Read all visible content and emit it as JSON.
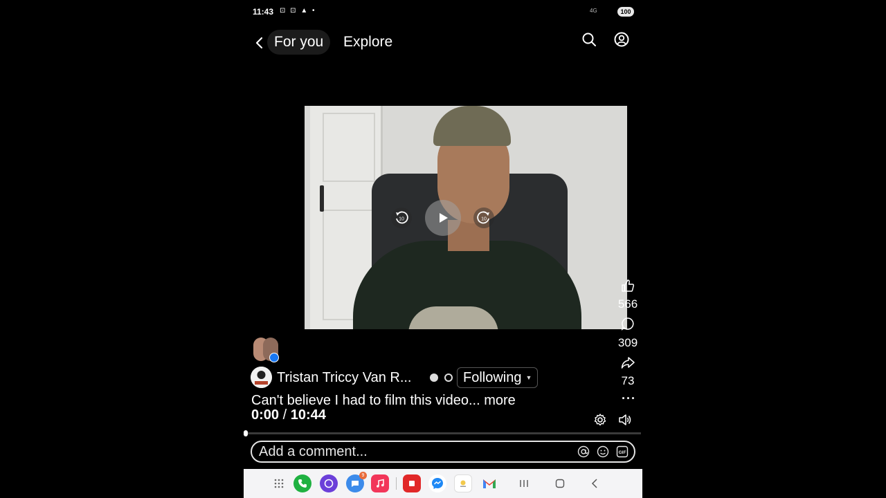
{
  "status_bar": {
    "time": "11:43",
    "network": "4G",
    "battery": "100"
  },
  "header": {
    "tabs": [
      {
        "label": "For you",
        "active": true
      },
      {
        "label": "Explore",
        "active": false
      }
    ],
    "icons": [
      "back-icon",
      "search-icon",
      "profile-icon"
    ]
  },
  "video": {
    "controls": [
      "rewind-10-icon",
      "play-icon",
      "forward-10-icon"
    ],
    "rewind_label": "10",
    "forward_label": "10",
    "current_time": "0:00",
    "separator": "/",
    "duration": "10:44",
    "progress_fraction": 0.0
  },
  "engagement": {
    "likes": "566",
    "comments": "309",
    "shares": "73",
    "more": "···"
  },
  "post": {
    "author": "Tristan Triccy Van R...",
    "following_label": "Following",
    "caption": "Can't believe I had to film this video...",
    "more_label": "more"
  },
  "comment_box": {
    "placeholder": "Add a comment..."
  },
  "navbar": {
    "apps": [
      "apps-grid-icon",
      "phone-icon",
      "browser-icon",
      "messages-icon",
      "music-icon",
      "flipboard-icon",
      "messenger-icon",
      "clipboard-app-icon",
      "gmail-icon"
    ],
    "messages_badge": "9",
    "system": [
      "recents-icon",
      "home-icon",
      "back-nav-icon"
    ]
  },
  "colors": {
    "background": "#000000",
    "text": "#ffffff",
    "navbar": "#f4f4f6",
    "facebook_blue": "#1877f2"
  }
}
